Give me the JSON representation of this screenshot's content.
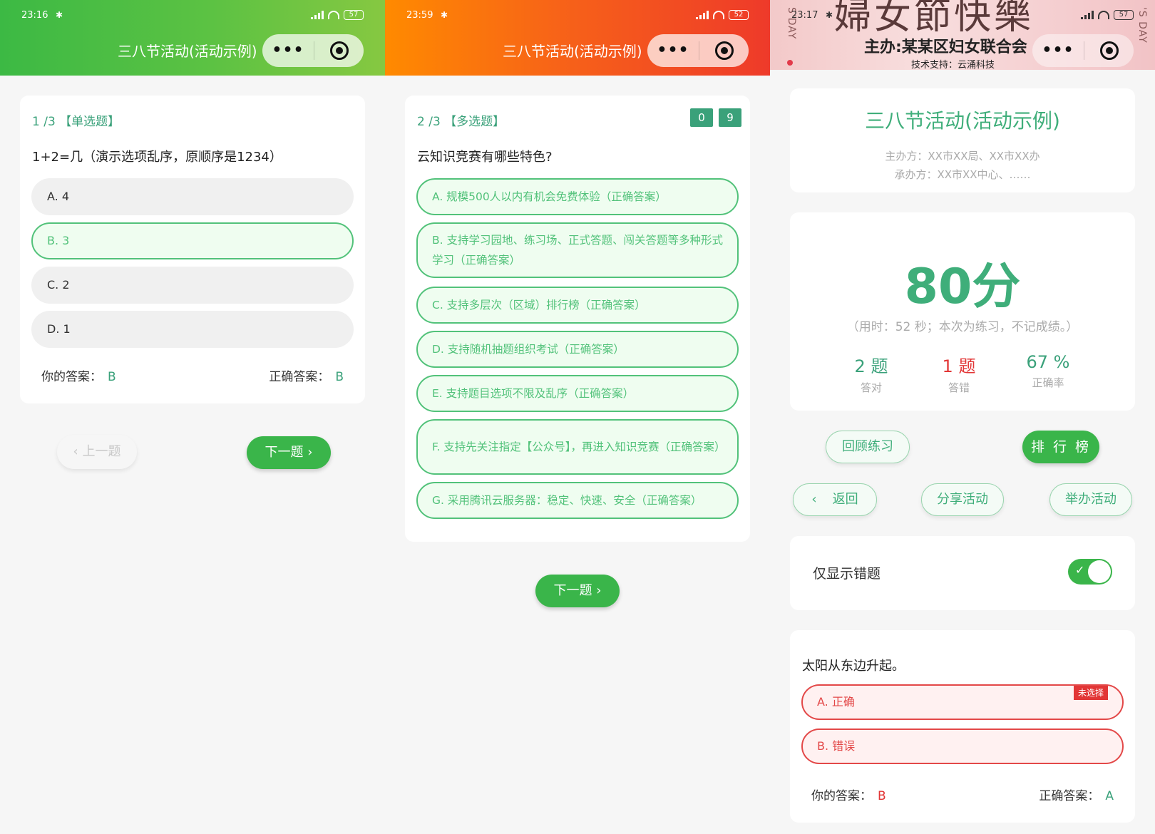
{
  "screens": [
    {
      "time": "23:16",
      "battery": "57",
      "nav_title": "三八节活动(活动示例)",
      "question_num": "1 /3 【单选题】",
      "question": "1+2=几（演示选项乱序，原顺序是1234）",
      "options": [
        "A. 4",
        "B. 3",
        "C. 2",
        "D. 1"
      ],
      "selected_index": 1,
      "your_answer_label": "你的答案：",
      "your_answer": "B",
      "correct_answer_label": "正确答案：",
      "correct_answer": "B",
      "prev_label": "上一题",
      "next_label": "下一题"
    },
    {
      "time": "23:59",
      "battery": "52",
      "nav_title": "三八节活动(活动示例)",
      "question_num": "2 /3 【多选题】",
      "counter_a": "0",
      "counter_b": "9",
      "question": "云知识竞赛有哪些特色?",
      "options": [
        "A. 规模500人以内有机会免费体验（正确答案）",
        "B. 支持学习园地、练习场、正式答题、闯关答题等多种形式学习（正确答案）",
        "C. 支持多层次（区域）排行榜（正确答案）",
        "D. 支持随机抽题组织考试（正确答案）",
        "E. 支持题目选项不限及乱序（正确答案）",
        "F. 支持先关注指定【公众号】，再进入知识竞赛（正确答案）",
        "G. 采用腾讯云服务器：稳定、快速、安全（正确答案）"
      ],
      "next_label": "下一题"
    },
    {
      "time": "23:17",
      "battery": "57",
      "banner_title": "婦女節快樂",
      "banner_organizer": "主办:某某区妇女联合会",
      "banner_tech": "技术支持：云涌科技",
      "banner_vertical_left": "S'DAY",
      "banner_vertical_right": "'S DAY",
      "activity_title": "三八节活动(活动示例)",
      "host": "主办方：XX市XX局、XX市XX办",
      "organizer": "承办方：XX市XX中心、……",
      "score": "80分",
      "timing": "（用时：52 秒；本次为练习，不记成绩。）",
      "stats": [
        {
          "value": "2 题",
          "label": "答对"
        },
        {
          "value": "1 题",
          "label": "答错"
        },
        {
          "value": "67 %",
          "label": "正确率"
        }
      ],
      "review_label": "回顾练习",
      "ranking_label": "排 行 榜",
      "back_label": "返回",
      "share_label": "分享活动",
      "host_activity_label": "举办活动",
      "only_wrong_label": "仅显示错题",
      "only_wrong_on": true,
      "question": "太阳从东边升起。",
      "options": [
        "A. 正确",
        "B. 错误"
      ],
      "unselected_badge": "未选择",
      "your_answer_label": "你的答案：",
      "your_answer": "B",
      "correct_answer_label": "正确答案：",
      "correct_answer": "A"
    }
  ],
  "colors": {
    "green": "#3ab54a",
    "teal": "#3aa17a",
    "red": "#e23636"
  }
}
